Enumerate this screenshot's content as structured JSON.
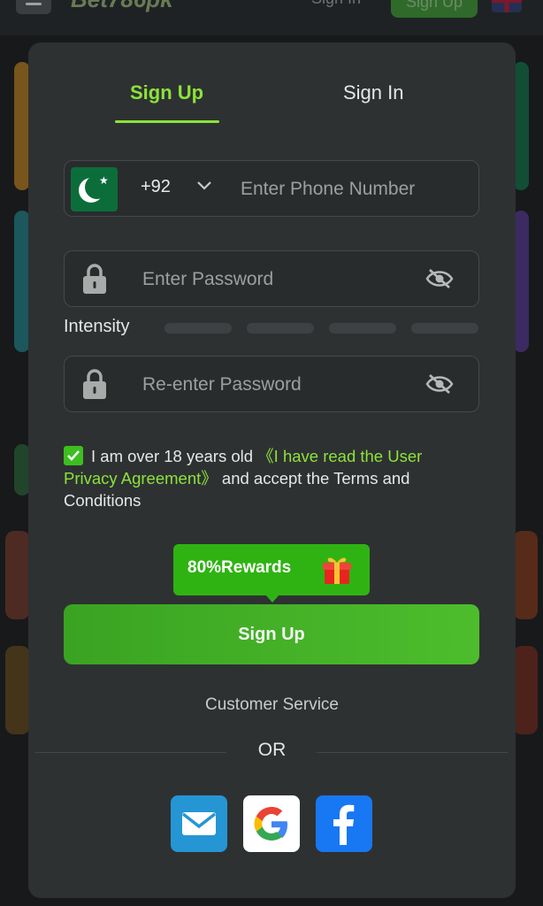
{
  "background": {
    "logo_text": "Bet786pk",
    "header_signin": "Sign In",
    "header_signup": "Sign Up"
  },
  "tabs": {
    "signup": "Sign Up",
    "signin": "Sign In",
    "active": "signup"
  },
  "phone": {
    "country_code": "+92",
    "placeholder": "Enter Phone Number"
  },
  "password": {
    "placeholder": "Enter Password",
    "confirm_placeholder": "Re-enter Password"
  },
  "intensity": {
    "label": "Intensity",
    "level": 0,
    "segments": 4
  },
  "agreement": {
    "checked": true,
    "text_before": "I am over 18 years old ",
    "link_text": "《I have read the User Privacy Agreement》",
    "text_after": " and accept the Terms and Conditions"
  },
  "rewards": {
    "label": "80%Rewards"
  },
  "actions": {
    "signup_button": "Sign Up",
    "customer_service": "Customer Service",
    "or_text": "OR"
  },
  "social": {
    "email": "email-icon",
    "google": "google-icon",
    "facebook": "facebook-icon"
  },
  "colors": {
    "accent": "#8be33a",
    "button": "#43b327",
    "modal_bg": "#2e3132"
  }
}
